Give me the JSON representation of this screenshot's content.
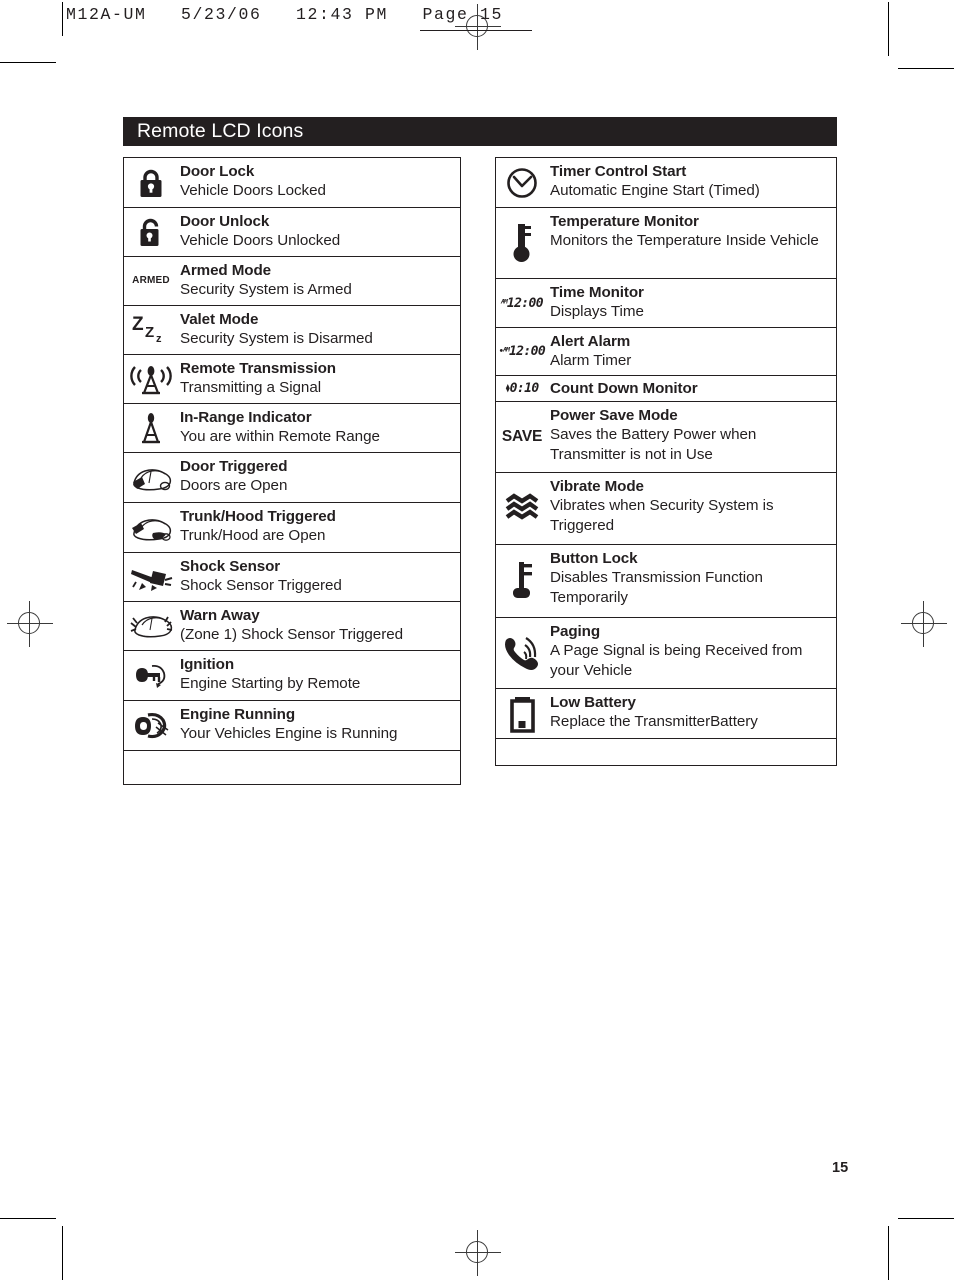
{
  "printer_slug": "M12A-UM   5/23/06   12:43 PM   Page 15",
  "page_number": "15",
  "header": {
    "title": "Remote LCD Icons",
    "background_color": "#231f20",
    "text_color": "#ffffff"
  },
  "columns": {
    "left": [
      {
        "icon": "padlock-closed-icon",
        "title": "Door Lock",
        "desc": "Vehicle Doors Locked"
      },
      {
        "icon": "padlock-open-icon",
        "title": "Door Unlock",
        "desc": " Vehicle Doors Unlocked"
      },
      {
        "icon": "armed-text-icon",
        "icon_text": "ARMED",
        "title": "Armed Mode",
        "desc": "Security System is Armed"
      },
      {
        "icon": "sleeping-zzz-icon",
        "title": "Valet Mode",
        "desc": "Security System is Disarmed"
      },
      {
        "icon": "transmitting-antenna-icon",
        "title": "Remote Transmission",
        "desc": "Transmitting a Signal"
      },
      {
        "icon": "antenna-tower-icon",
        "title": "In-Range Indicator",
        "desc": "You are within Remote Range"
      },
      {
        "icon": "car-door-open-icon",
        "title": "Door Triggered",
        "desc": "Doors are Open"
      },
      {
        "icon": "car-trunk-hood-open-icon",
        "title": "Trunk/Hood Triggered",
        "desc": "Trunk/Hood are Open"
      },
      {
        "icon": "hammer-shock-icon",
        "title": "Shock Sensor",
        "desc": "Shock Sensor Triggered"
      },
      {
        "icon": "car-warn-away-icon",
        "title": "Warn Away",
        "desc": "(Zone 1) Shock Sensor Triggered"
      },
      {
        "icon": "ignition-key-turn-icon",
        "title": "Ignition",
        "desc": "Engine Starting by Remote"
      },
      {
        "icon": "engine-running-icon",
        "title": "Engine Running",
        "desc": "Your Vehicles Engine is Running"
      }
    ],
    "right": [
      {
        "icon": "clock-timer-icon",
        "title": "Timer Control Start",
        "desc": "Automatic Engine Start (Timed)"
      },
      {
        "icon": "thermometer-icon",
        "title": "Temperature Monitor",
        "desc": "Monitors the Temperature Inside Vehicle"
      },
      {
        "icon": "lcd-time-icon",
        "icon_text_superscript": "AM",
        "icon_text": "12:00",
        "title": "Time Monitor",
        "desc": "Displays Time"
      },
      {
        "icon": "lcd-alarm-time-icon",
        "icon_text_prefix": "•",
        "icon_text_superscript": "AM",
        "icon_text": "12:00",
        "title": "Alert Alarm",
        "desc": "Alarm Timer"
      },
      {
        "icon": "lcd-countdown-icon",
        "icon_text_prefix": "⧫",
        "icon_text": "0:10",
        "title": "Count Down Monitor",
        "desc": "",
        "inline": true
      },
      {
        "icon": "save-text-icon",
        "icon_text": "SAVE",
        "title": "Power Save Mode",
        "desc": "Saves the Battery Power when Transmitter is not in Use"
      },
      {
        "icon": "vibrate-waves-icon",
        "title": "Vibrate Mode",
        "desc": "Vibrates when Security System is Triggered"
      },
      {
        "icon": "key-button-lock-icon",
        "title": "Button Lock",
        "desc": "Disables Transmission Function Temporarily"
      },
      {
        "icon": "phone-paging-icon",
        "title": "Paging",
        "desc": "A Page Signal is being Received from your Vehicle"
      },
      {
        "icon": "low-battery-icon",
        "title": "Low Battery",
        "desc": "Replace the TransmitterBattery"
      }
    ]
  }
}
